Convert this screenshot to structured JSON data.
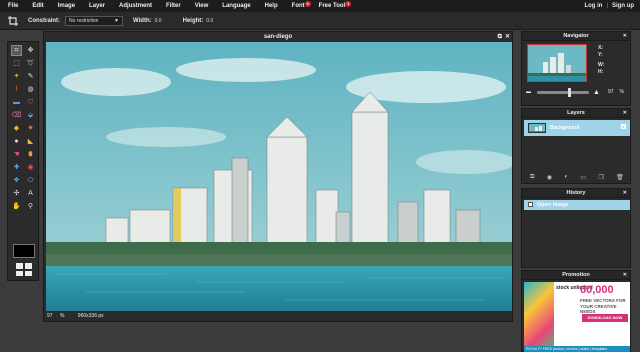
{
  "menubar": {
    "items": [
      {
        "label": "File"
      },
      {
        "label": "Edit"
      },
      {
        "label": "Image"
      },
      {
        "label": "Layer"
      },
      {
        "label": "Adjustment"
      },
      {
        "label": "Filter"
      },
      {
        "label": "View"
      },
      {
        "label": "Language"
      },
      {
        "label": "Help"
      },
      {
        "label": "Font",
        "badge": "4"
      },
      {
        "label": "Free Tool",
        "badge": "1"
      }
    ],
    "login_label": "Log in",
    "separator": "|",
    "signup_label": "Sign up"
  },
  "options": {
    "constraint_label": "Constraint:",
    "constraint_value": "No restriction",
    "width_label": "Width:",
    "width_value": "0.0",
    "height_label": "Height:",
    "height_value": "0.0"
  },
  "document": {
    "title": "san-diego",
    "zoom": "97",
    "zoom_unit": "%",
    "dimensions": "960x336 px"
  },
  "navigator": {
    "title": "Navigator",
    "x_label": "X:",
    "y_label": "Y:",
    "w_label": "W:",
    "h_label": "H:",
    "zoom": "97",
    "zoom_unit": "%",
    "zoom_fraction": 0.6
  },
  "layers": {
    "title": "Layers",
    "items": [
      {
        "name": "Background"
      }
    ]
  },
  "history": {
    "title": "History",
    "items": [
      {
        "label": "Open image"
      }
    ]
  },
  "promotion": {
    "title": "Promotion",
    "brand": "stock unlimited",
    "big_number": "60,000",
    "copy": "FREE VECTORS FOR YOUR CREATIVE NEEDS",
    "button": "DOWNLOAD NOW",
    "footer": "ROYALTY FREE  photos | vectors | audio | templates"
  },
  "colors": {
    "selection": "#9fd3ea",
    "menubar": "#1d1d1d",
    "panel": "#2b2b2b",
    "badge": "#d8202a"
  }
}
